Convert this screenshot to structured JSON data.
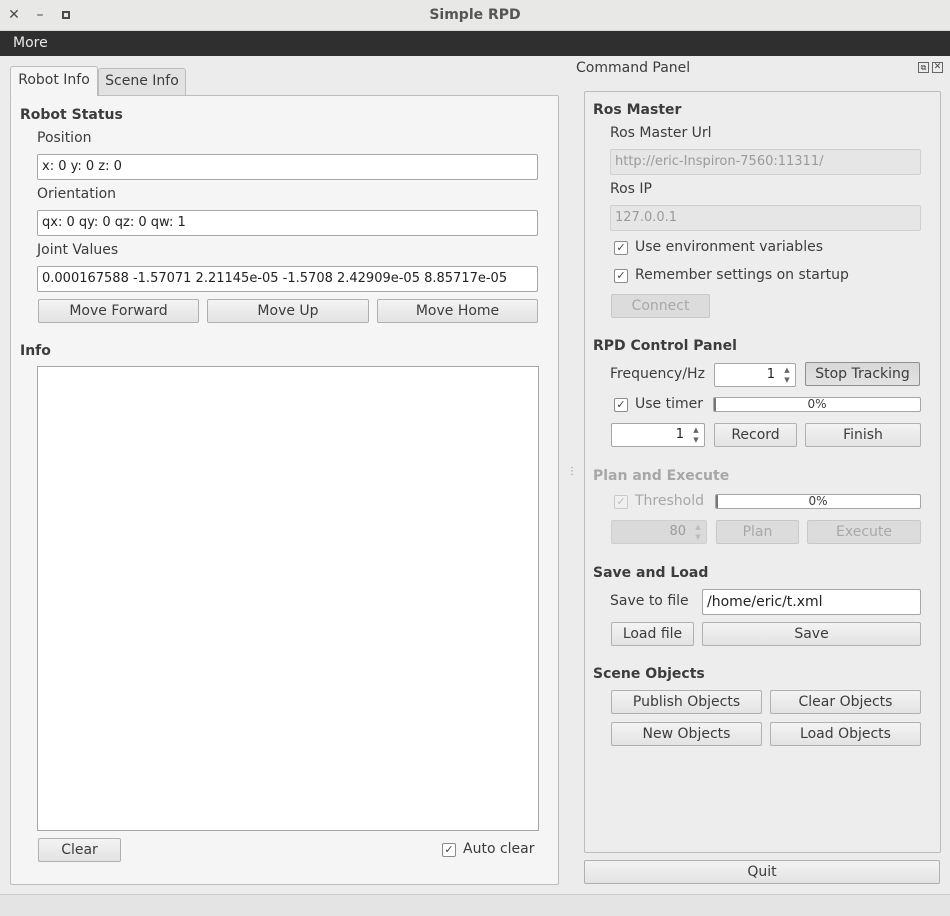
{
  "window": {
    "title": "Simple RPD",
    "controls": [
      "×",
      "–",
      "▫"
    ]
  },
  "menu": {
    "more": "More"
  },
  "tabs": {
    "robot_info": "Robot Info",
    "scene_info": "Scene Info"
  },
  "robot_status": {
    "heading": "Robot Status",
    "position_label": "Position",
    "position_value": "x: 0 y: 0 z: 0",
    "orientation_label": "Orientation",
    "orientation_value": "qx: 0 qy: 0 qz: 0 qw: 1",
    "joint_label": "Joint Values",
    "joint_value": "0.000167588 -1.57071 2.21145e-05 -1.5708 2.42909e-05 8.85717e-05",
    "move_forward": "Move Forward",
    "move_up": "Move Up",
    "move_home": "Move Home"
  },
  "info": {
    "heading": "Info",
    "log_text": "",
    "clear": "Clear",
    "auto_clear": "Auto clear",
    "auto_clear_checked": true
  },
  "command_panel": {
    "title": "Command Panel",
    "ros_master": {
      "heading": "Ros Master",
      "url_label": "Ros Master Url",
      "url_value": "http://eric-Inspiron-7560:11311/",
      "ip_label": "Ros IP",
      "ip_value": "127.0.0.1",
      "use_env": "Use environment variables",
      "remember": "Remember settings on startup",
      "connect": "Connect"
    },
    "rpd_control": {
      "heading": "RPD Control Panel",
      "frequency_label": "Frequency/Hz",
      "frequency_value": "1",
      "stop_tracking": "Stop Tracking",
      "use_timer": "Use timer",
      "timer_progress_text": "0%",
      "timer_progress": 0.01,
      "counter_value": "1",
      "record": "Record",
      "finish": "Finish"
    },
    "plan_execute": {
      "heading": "Plan and Execute",
      "threshold": "Threshold",
      "threshold_progress_text": "0%",
      "threshold_progress": 0.01,
      "threshold_value": "80",
      "plan": "Plan",
      "execute": "Execute"
    },
    "save_load": {
      "heading": "Save and Load",
      "save_to_file_label": "Save to file",
      "file_path": "/home/eric/t.xml",
      "load_file": "Load file",
      "save": "Save"
    },
    "scene_objects": {
      "heading": "Scene Objects",
      "publish": "Publish Objects",
      "clear": "Clear Objects",
      "new": "New Objects",
      "load": "Load Objects"
    },
    "quit": "Quit"
  }
}
